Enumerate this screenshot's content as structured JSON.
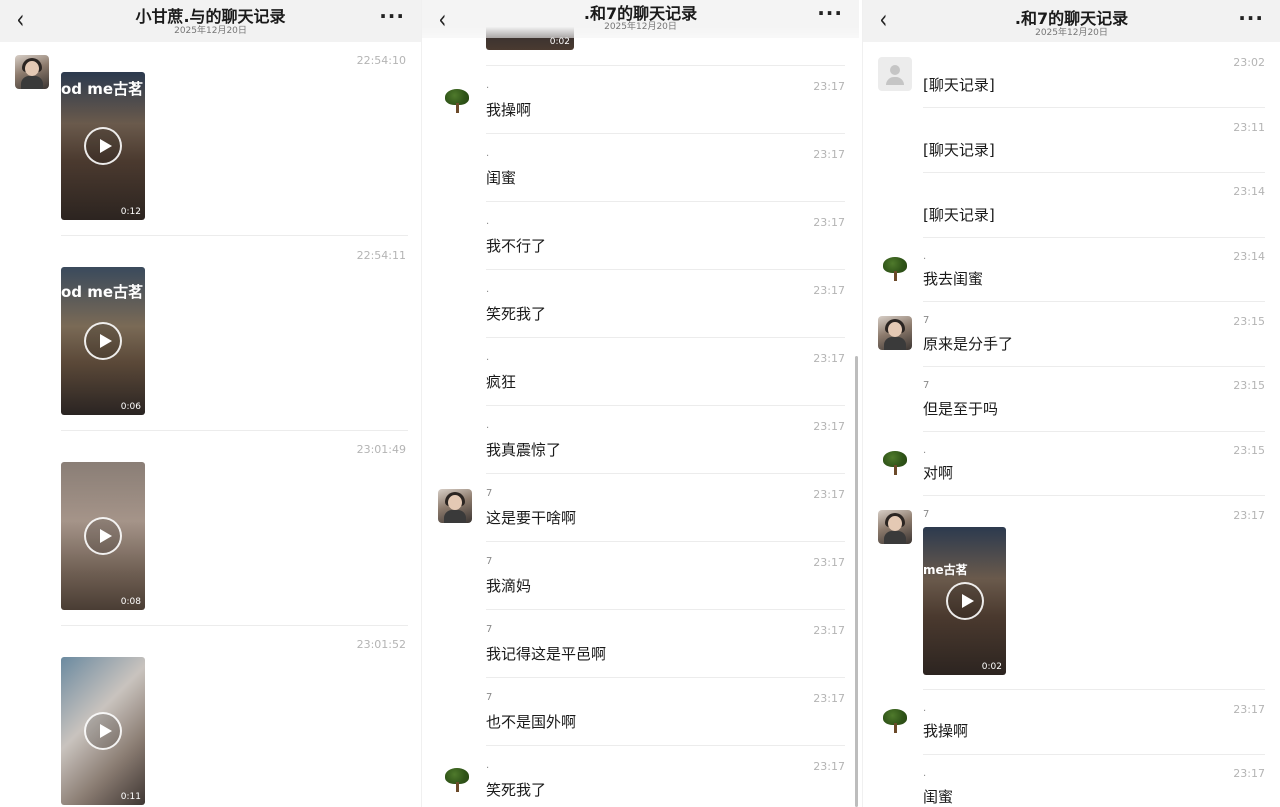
{
  "panel1": {
    "header": {
      "title": "小甘蔗.与的聊天记录",
      "date": "2025年12月20日",
      "back": "‹",
      "more": "···"
    },
    "messages": [
      {
        "time": "22:54:10",
        "duration": "0:12",
        "sign": "od me古茗"
      },
      {
        "time": "22:54:11",
        "duration": "0:06",
        "sign": "od me古茗"
      },
      {
        "time": "23:01:49",
        "duration": "0:08"
      },
      {
        "time": "23:01:52",
        "duration": "0:11"
      }
    ]
  },
  "panel2": {
    "header": {
      "title": ".和7的聊天记录",
      "date": "2025年12月20日",
      "back": "‹",
      "more": "···"
    },
    "top_video_duration": "0:02",
    "messages": [
      {
        "sender": ".",
        "time": "23:17",
        "text": "我操啊"
      },
      {
        "sender": ".",
        "time": "23:17",
        "text": "闺蜜"
      },
      {
        "sender": ".",
        "time": "23:17",
        "text": "我不行了"
      },
      {
        "sender": ".",
        "time": "23:17",
        "text": "笑死我了"
      },
      {
        "sender": ".",
        "time": "23:17",
        "text": "疯狂"
      },
      {
        "sender": ".",
        "time": "23:17",
        "text": "我真震惊了"
      },
      {
        "sender": "7",
        "time": "23:17",
        "text": "这是要干啥啊"
      },
      {
        "sender": "7",
        "time": "23:17",
        "text": "我滴妈"
      },
      {
        "sender": "7",
        "time": "23:17",
        "text": "我记得这是平邑啊"
      },
      {
        "sender": "7",
        "time": "23:17",
        "text": "也不是国外啊"
      },
      {
        "sender": ".",
        "time": "23:17",
        "text": "笑死我了"
      }
    ]
  },
  "panel3": {
    "header": {
      "title": ".和7的聊天记录",
      "date": "2025年12月20日",
      "back": "‹",
      "more": "···"
    },
    "messages": [
      {
        "time": "23:02",
        "text": "[聊天记录]"
      },
      {
        "time": "23:11",
        "text": "[聊天记录]"
      },
      {
        "time": "23:14",
        "text": "[聊天记录]"
      },
      {
        "sender": ".",
        "time": "23:14",
        "text": "我去闺蜜"
      },
      {
        "sender": "7",
        "time": "23:15",
        "text": "原来是分手了"
      },
      {
        "sender": "7",
        "time": "23:15",
        "text": "但是至于吗"
      },
      {
        "sender": ".",
        "time": "23:15",
        "text": "对啊"
      },
      {
        "sender": "7",
        "time": "23:17",
        "duration": "0:02",
        "sign": "me古茗"
      },
      {
        "sender": ".",
        "time": "23:17",
        "text": "我操啊"
      },
      {
        "sender": ".",
        "time": "23:17",
        "text": "闺蜜"
      }
    ]
  },
  "colors": {
    "header_bg": "#f2f2f2",
    "timestamp": "#b4b4b4",
    "separator": "#ececec",
    "text": "#1a1a1a"
  },
  "icons": [
    "back-chevron-icon",
    "more-dots-icon",
    "play-icon",
    "tree-avatar-icon",
    "default-avatar-icon"
  ]
}
